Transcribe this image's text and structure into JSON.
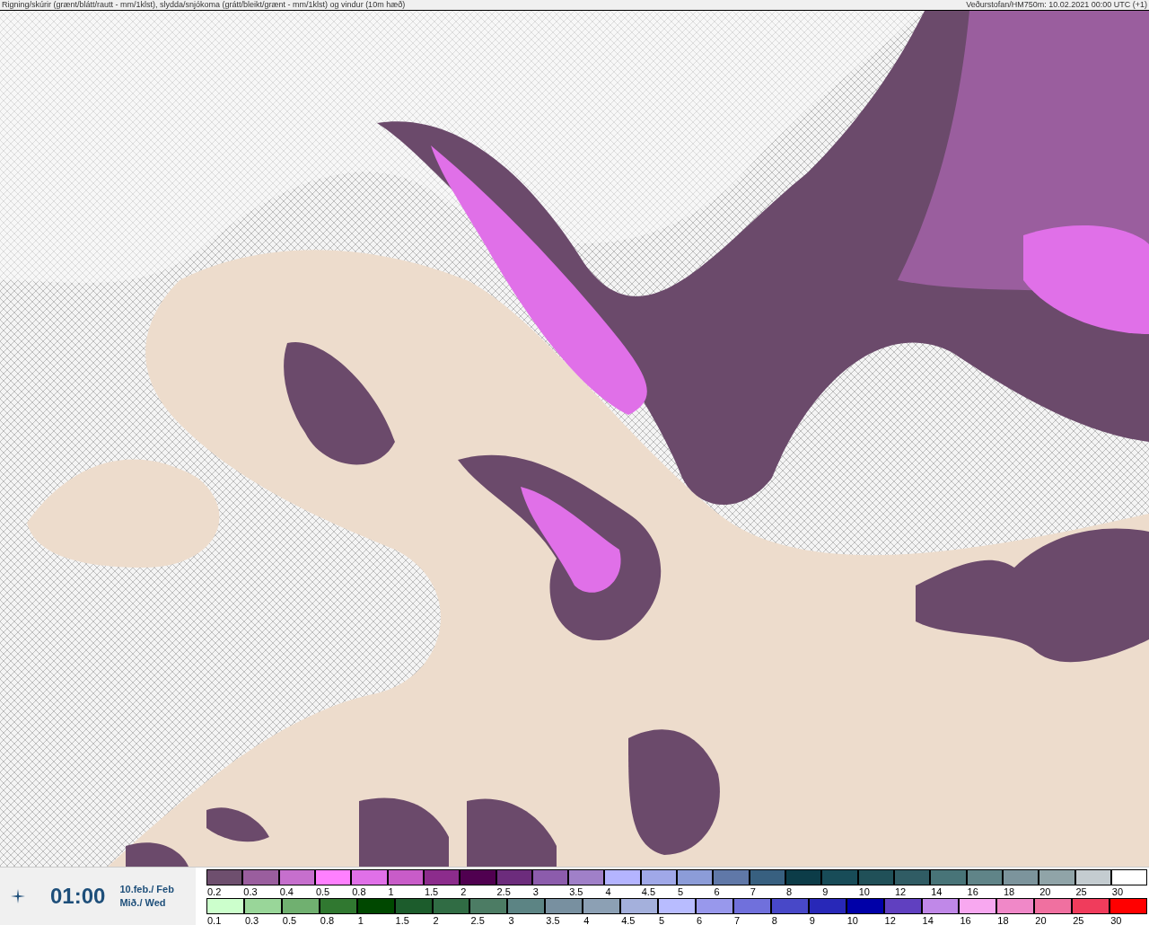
{
  "header": {
    "title": "Rigning/skúrir (grænt/blátt/rautt - mm/1klst), slydda/snjókoma (grátt/bleikt/grænt - mm/1klst) og vindur (10m hæð)",
    "source": "Veðurstofan/HM750m: 10.02.2021 00:00 UTC (+1)"
  },
  "time_panel": {
    "time": "01:00",
    "date": "10.feb./ Feb",
    "weekday": "Mið./ Wed"
  },
  "legend": {
    "snow": [
      {
        "label": "0.2",
        "color": "#6e4f6e"
      },
      {
        "label": "0.3",
        "color": "#9a5e9e"
      },
      {
        "label": "0.4",
        "color": "#c66fcd"
      },
      {
        "label": "0.5",
        "color": "#ff80ff"
      },
      {
        "label": "0.8",
        "color": "#e070e8"
      },
      {
        "label": "1",
        "color": "#c85cc8"
      },
      {
        "label": "1.5",
        "color": "#8c2c8c"
      },
      {
        "label": "2",
        "color": "#500050"
      },
      {
        "label": "2.5",
        "color": "#6c2c7c"
      },
      {
        "label": "3",
        "color": "#8c5cac"
      },
      {
        "label": "3.5",
        "color": "#a080c8"
      },
      {
        "label": "4",
        "color": "#b4b4ff"
      },
      {
        "label": "4.5",
        "color": "#a0a8e8"
      },
      {
        "label": "5",
        "color": "#8c9cd8"
      },
      {
        "label": "6",
        "color": "#6078a8"
      },
      {
        "label": "7",
        "color": "#386080"
      },
      {
        "label": "8",
        "color": "#0c3c48"
      },
      {
        "label": "9",
        "color": "#184c58"
      },
      {
        "label": "10",
        "color": "#205058"
      },
      {
        "label": "12",
        "color": "#305c64"
      },
      {
        "label": "14",
        "color": "#487478"
      },
      {
        "label": "16",
        "color": "#608488"
      },
      {
        "label": "18",
        "color": "#7c949c"
      },
      {
        "label": "20",
        "color": "#90a4a8"
      },
      {
        "label": "25",
        "color": "#c4ccd0"
      },
      {
        "label": "30",
        "color": "#ffffff"
      }
    ],
    "rain": [
      {
        "label": "0.1",
        "color": "#ccffcc"
      },
      {
        "label": "0.3",
        "color": "#99d699"
      },
      {
        "label": "0.5",
        "color": "#70b070"
      },
      {
        "label": "0.8",
        "color": "#307830"
      },
      {
        "label": "1",
        "color": "#004800"
      },
      {
        "label": "1.5",
        "color": "#1c5c2c"
      },
      {
        "label": "2",
        "color": "#306c44"
      },
      {
        "label": "2.5",
        "color": "#4c7c64"
      },
      {
        "label": "3",
        "color": "#5c8484"
      },
      {
        "label": "3.5",
        "color": "#7890a0"
      },
      {
        "label": "4",
        "color": "#8ca0b4"
      },
      {
        "label": "4.5",
        "color": "#a4b0dc"
      },
      {
        "label": "5",
        "color": "#b8bcff"
      },
      {
        "label": "6",
        "color": "#9898ec"
      },
      {
        "label": "7",
        "color": "#7070dc"
      },
      {
        "label": "8",
        "color": "#4848c8"
      },
      {
        "label": "9",
        "color": "#2828b8"
      },
      {
        "label": "10",
        "color": "#0000a8"
      },
      {
        "label": "12",
        "color": "#6040c0"
      },
      {
        "label": "14",
        "color": "#c088e8"
      },
      {
        "label": "16",
        "color": "#f8a8f0"
      },
      {
        "label": "18",
        "color": "#f088c8"
      },
      {
        "label": "20",
        "color": "#f070a0"
      },
      {
        "label": "25",
        "color": "#f03c5c"
      },
      {
        "label": "30",
        "color": "#ff0000"
      }
    ]
  }
}
